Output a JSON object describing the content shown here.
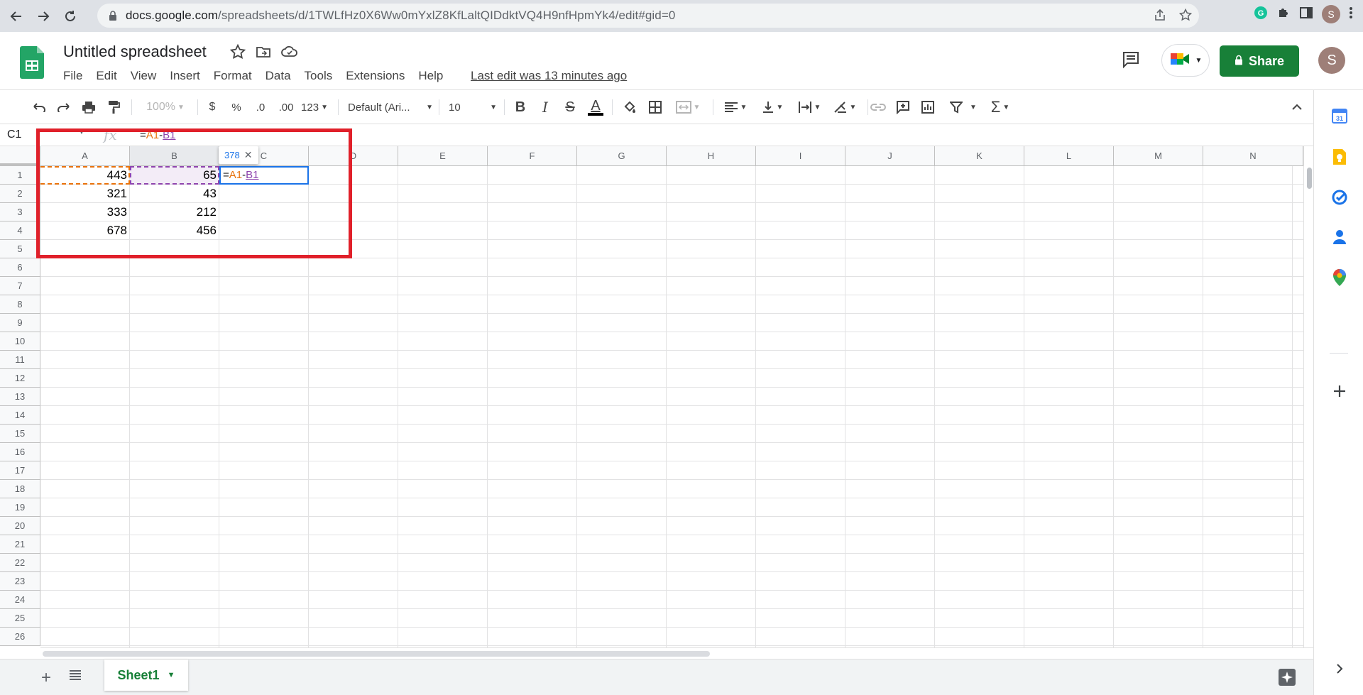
{
  "browser": {
    "url_host": "docs.google.com",
    "url_path": "/spreadsheets/d/1TWLfHz0X6Ww0mYxlZ8KfLaltQIDdktVQ4H9nfHpmYk4/edit#gid=0",
    "profile_initial": "S"
  },
  "header": {
    "doc_title": "Untitled spreadsheet",
    "menu": [
      "File",
      "Edit",
      "View",
      "Insert",
      "Format",
      "Data",
      "Tools",
      "Extensions",
      "Help"
    ],
    "last_edit": "Last edit was 13 minutes ago",
    "share_label": "Share",
    "avatar_initial": "S"
  },
  "toolbar": {
    "zoom": "100%",
    "currency": "$",
    "percent": "%",
    "decrease_decimal": ".0",
    "increase_decimal": ".00",
    "more_formats": "123",
    "font_family": "Default (Ari...",
    "font_size": "10",
    "bold": "B",
    "italic": "I",
    "strikethrough": "S",
    "text_color": "A",
    "sum": "Σ"
  },
  "formula_bar": {
    "name_box": "C1",
    "fx": "fx",
    "formula_eq": "=",
    "formula_ref_a": "A1",
    "formula_op": "-",
    "formula_ref_b": "B1"
  },
  "grid": {
    "columns": [
      "A",
      "B",
      "C",
      "D",
      "E",
      "F",
      "G",
      "H",
      "I",
      "J",
      "K",
      "L",
      "M",
      "N"
    ],
    "rows": [
      "1",
      "2",
      "3",
      "4",
      "5",
      "6",
      "7",
      "8",
      "9",
      "10",
      "11",
      "12",
      "13",
      "14",
      "15",
      "16",
      "17",
      "18",
      "19",
      "20",
      "21",
      "22",
      "23",
      "24",
      "25",
      "26"
    ],
    "data": [
      [
        "443",
        "65"
      ],
      [
        "321",
        "43"
      ],
      [
        "333",
        "212"
      ],
      [
        "678",
        "456"
      ]
    ],
    "active_cell": "C1",
    "preview_value": "378"
  },
  "sheets": {
    "tabs": [
      "Sheet1"
    ]
  },
  "colors": {
    "accent_green": "#188038",
    "selection_blue": "#1a73e8",
    "ref_a_orange": "#e8710a",
    "ref_b_purple": "#8e44ad",
    "annotation_red": "#e0202a"
  }
}
